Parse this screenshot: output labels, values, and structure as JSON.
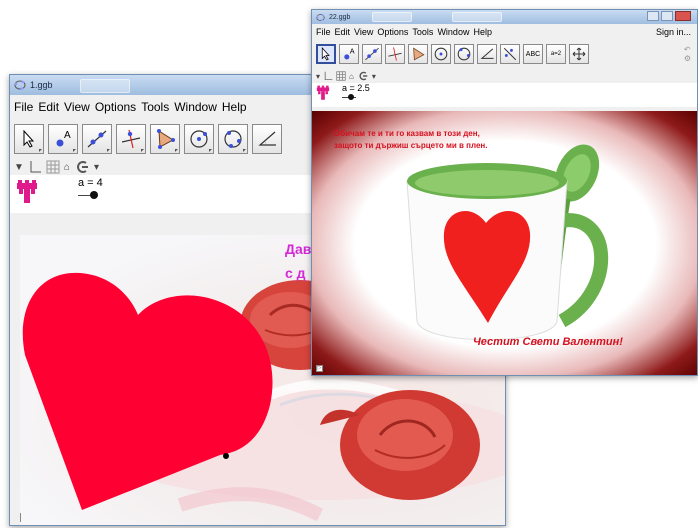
{
  "window1": {
    "title": "1.ggb",
    "menu": [
      "File",
      "Edit",
      "View",
      "Options",
      "Tools",
      "Window",
      "Help"
    ],
    "tools": [
      "move-tool",
      "point-tool",
      "line-tool",
      "perpendicular-tool",
      "polygon-tool",
      "circle-tool",
      "conic-tool",
      "angle-tool"
    ],
    "slider": {
      "label": "a = 4",
      "value": 4
    },
    "canvas_text": [
      "Дав",
      "с д"
    ]
  },
  "window2": {
    "title": "22.ggb",
    "menu": [
      "File",
      "Edit",
      "View",
      "Options",
      "Tools",
      "Window",
      "Help"
    ],
    "signin": "Sign in...",
    "tools": [
      "move-tool",
      "point-tool",
      "line-tool",
      "perpendicular-tool",
      "polygon-tool",
      "circle-tool",
      "conic-tool",
      "angle-tool",
      "reflect-tool",
      "text-tool",
      "slider-tool",
      "move-view-tool"
    ],
    "text_tool_label": "ABC",
    "slider_tool_label": "a=2",
    "slider": {
      "label": "a = 2.5",
      "value": 2.5
    },
    "poem_line1": "Обичам те и ти го казвам в този ден,",
    "poem_line2": "защото ти държиш сърцето ми в плен.",
    "greeting": "Честит Свети Валентин!"
  },
  "colors": {
    "heart": "#ff0033",
    "mug_heart": "#f0201e",
    "cup_green": "#6ab04c",
    "poem_red": "#d4111f",
    "canvas_magenta": "#d42ad6"
  }
}
